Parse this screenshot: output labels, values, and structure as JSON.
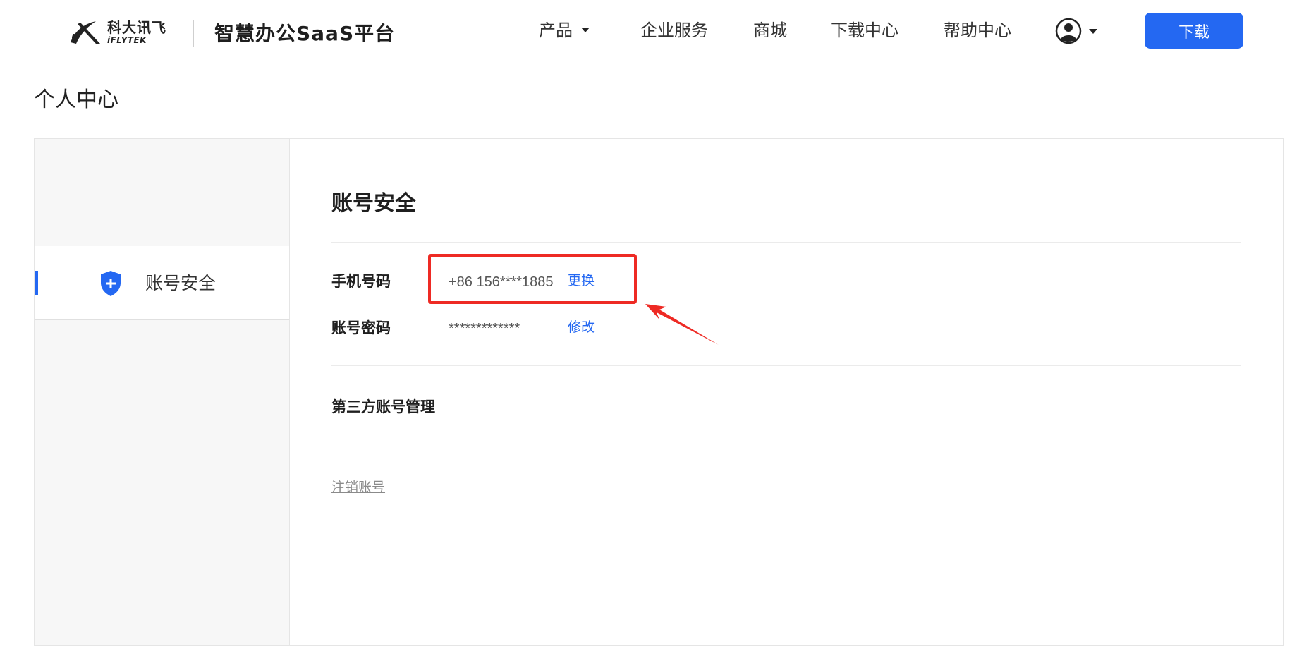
{
  "header": {
    "logo": {
      "cn_text": "科大讯飞",
      "en_text": "iFLYTEK"
    },
    "platform_title": "智慧办公SaaS平台",
    "nav": {
      "products": "产品",
      "enterprise_services": "企业服务",
      "mall": "商城",
      "download_center": "下载中心",
      "help_center": "帮助中心"
    },
    "download_button": "下载"
  },
  "page": {
    "title": "个人中心"
  },
  "sidebar": {
    "items": [
      {
        "label": "账号安全",
        "icon": "shield-plus-icon",
        "active": true
      }
    ]
  },
  "account_security": {
    "title": "账号安全",
    "phone": {
      "label": "手机号码",
      "value": "+86 156****1885",
      "action": "更换"
    },
    "password": {
      "label": "账号密码",
      "value": "*************",
      "action": "修改"
    },
    "third_party_title": "第三方账号管理",
    "cancel_account": "注销账号"
  },
  "colors": {
    "accent": "#2468f2",
    "annotation": "#ee2a24",
    "sidebar_bg": "#f7f7f7"
  }
}
